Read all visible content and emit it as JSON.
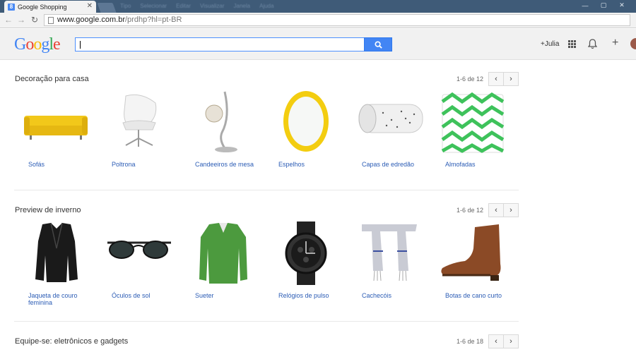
{
  "browser": {
    "tab_title": "Google Shopping",
    "tab_favicon": "8",
    "menu_blur": [
      "",
      "Tipo",
      "Selecionar",
      "Editar",
      "Visualizar",
      "Janela",
      "Ajuda"
    ],
    "url_host": "www.google.com.br",
    "url_path": "/prdhp?hl=pt-BR"
  },
  "header": {
    "logo_letters": [
      "G",
      "o",
      "o",
      "g",
      "l",
      "e"
    ],
    "logo_colors": [
      "#4285f4",
      "#ea4335",
      "#fbbc05",
      "#4285f4",
      "#34a853",
      "#ea4335"
    ],
    "user": "+Julia"
  },
  "sections": [
    {
      "title": "Decoração para casa",
      "pager": "1-6 de 12",
      "items": [
        {
          "label": "Sofás",
          "icon": "sofa-icon"
        },
        {
          "label": "Poltrona",
          "icon": "armchair-icon"
        },
        {
          "label": "Candeeiros de mesa",
          "icon": "lamp-icon"
        },
        {
          "label": "Espelhos",
          "icon": "mirror-icon"
        },
        {
          "label": "Capas de edredão",
          "icon": "duvet-icon"
        },
        {
          "label": "Almofadas",
          "icon": "cushion-icon"
        }
      ]
    },
    {
      "title": "Preview de inverno",
      "pager": "1-6 de 12",
      "items": [
        {
          "label": "Jaqueta de couro feminina",
          "icon": "jacket-icon"
        },
        {
          "label": "Óculos de sol",
          "icon": "sunglasses-icon"
        },
        {
          "label": "Sueter",
          "icon": "sweater-icon"
        },
        {
          "label": "Relógios de pulso",
          "icon": "watch-icon"
        },
        {
          "label": "Cachecóis",
          "icon": "scarf-icon"
        },
        {
          "label": "Botas de cano curto",
          "icon": "boot-icon"
        }
      ]
    },
    {
      "title": "Equipe-se: eletrônicos e gadgets",
      "pager": "1-6 de 18",
      "items": []
    }
  ]
}
